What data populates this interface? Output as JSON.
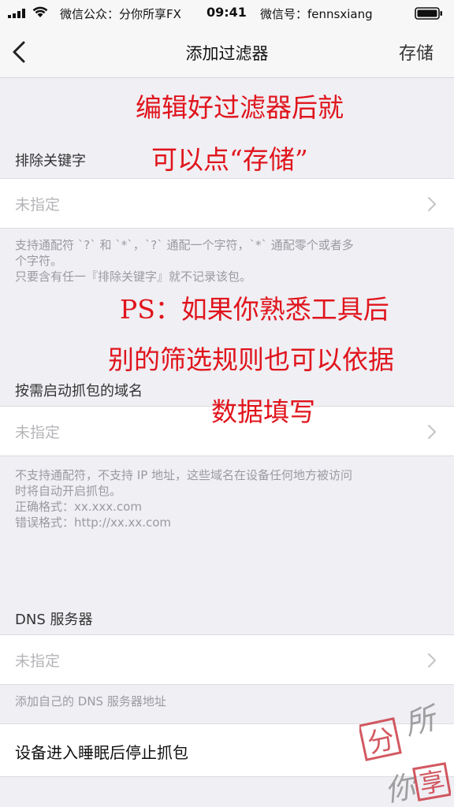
{
  "status_bar": {
    "carrier": "微信公众：分你所享FX",
    "time": "09:41",
    "wechat": "微信号：fennsxiang",
    "icons": [
      "signal-icon",
      "wifi-icon",
      "battery-icon"
    ]
  },
  "nav": {
    "back_icon": "chevron-left-icon",
    "title": "添加过滤器",
    "save_label": "存储"
  },
  "sections": [
    {
      "header": "排除关键字",
      "value": "未指定",
      "footnote_lines": [
        "支持通配符 `?` 和 `*`，`?` 通配一个字符，`*` 通配零个或者多",
        "个字符。",
        "只要含有任一『排除关键字』就不记录该包。"
      ]
    },
    {
      "header": "按需启动抓包的域名",
      "value": "未指定",
      "footnote_lines": [
        "不支持通配符，不支持 IP 地址，这些域名在设备任何地方被访问",
        "时将自动开启抓包。",
        "正确格式：xx.xxx.com",
        "错误格式：http://xx.xx.com"
      ]
    },
    {
      "header": "DNS 服务器",
      "value": "未指定",
      "footnote_lines": [
        "添加自己的 DNS 服务器地址"
      ]
    }
  ],
  "toggle_row": {
    "label": "设备进入睡眠后停止抓包"
  },
  "annotations": {
    "line1": "编辑好过滤器后就",
    "line2": "可以点“存储”",
    "line3": "PS：如果你熟悉工具后",
    "line4": "别的筛选规则也可以依据",
    "line5": "数据填写"
  },
  "watermark": {
    "chars": [
      "分",
      "所",
      "你",
      "享"
    ]
  },
  "colors": {
    "accent_red": "#e0141c",
    "background": "#efeff4",
    "placeholder": "#b5b5b9",
    "footnote": "#9a9aa0"
  }
}
